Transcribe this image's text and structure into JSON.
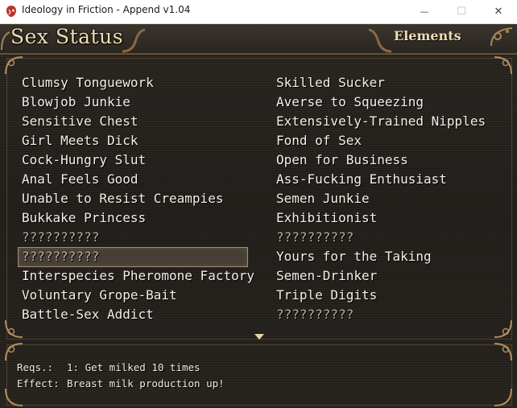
{
  "window": {
    "title": "Ideology in Friction - Append v1.04",
    "minimize_glyph": "—",
    "maximize_glyph": "☐",
    "close_glyph": "✕"
  },
  "header": {
    "title": "Sex Status",
    "tab_label": "Elements"
  },
  "skills": {
    "left": [
      {
        "label": "Clumsy Tonguework",
        "locked": false
      },
      {
        "label": "Blowjob Junkie",
        "locked": false
      },
      {
        "label": "Sensitive Chest",
        "locked": false
      },
      {
        "label": "Girl Meets Dick",
        "locked": false
      },
      {
        "label": "Cock-Hungry Slut",
        "locked": false
      },
      {
        "label": "Anal Feels Good",
        "locked": false
      },
      {
        "label": "Unable to Resist Creampies",
        "locked": false
      },
      {
        "label": "Bukkake Princess",
        "locked": false
      },
      {
        "label": "??????????",
        "locked": true
      },
      {
        "label": "??????????",
        "locked": true,
        "selected": true
      },
      {
        "label": "Interspecies Pheromone Factory",
        "locked": false
      },
      {
        "label": "Voluntary Grope-Bait",
        "locked": false
      },
      {
        "label": "Battle-Sex Addict",
        "locked": false
      }
    ],
    "right": [
      {
        "label": "Skilled Sucker",
        "locked": false
      },
      {
        "label": "Averse to Squeezing",
        "locked": false
      },
      {
        "label": "Extensively-Trained Nipples",
        "locked": false
      },
      {
        "label": "Fond of Sex",
        "locked": false
      },
      {
        "label": "Open for Business",
        "locked": false
      },
      {
        "label": "Ass-Fucking Enthusiast",
        "locked": false
      },
      {
        "label": "Semen Junkie",
        "locked": false
      },
      {
        "label": "Exhibitionist",
        "locked": false
      },
      {
        "label": "??????????",
        "locked": true
      },
      {
        "label": "Yours for the Taking",
        "locked": false
      },
      {
        "label": "Semen-Drinker",
        "locked": false
      },
      {
        "label": "Triple Digits",
        "locked": false
      },
      {
        "label": "??????????",
        "locked": true
      }
    ]
  },
  "help": {
    "reqs_label": "Reqs.:",
    "reqs_value": "1: Get milked 10 times",
    "effect_label": "Effect:",
    "effect_value": "Breast milk production up!"
  },
  "colors": {
    "text": "#f3f0e8",
    "locked_text": "#b7ada0",
    "title_gold": "#f0dcb4",
    "frame_bronze": "#8a6a42"
  }
}
